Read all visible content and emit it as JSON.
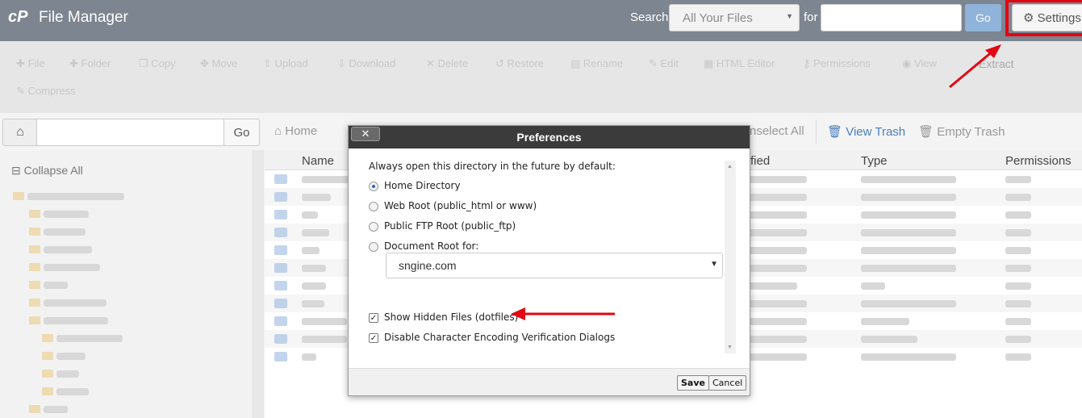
{
  "header": {
    "logo": "cP",
    "title": "File Manager",
    "search_label": "Search",
    "search_scope": "All Your Files",
    "for_label": "for",
    "search_value": "",
    "go_label": "Go",
    "settings_label": "Settings"
  },
  "toolbar": {
    "items": [
      "File",
      "Folder",
      "Copy",
      "Move",
      "Upload",
      "Download",
      "Delete",
      "Restore",
      "Rename",
      "Edit",
      "HTML Editor",
      "Permissions",
      "View",
      "Extract",
      "Compress"
    ]
  },
  "nav": {
    "path_value": "",
    "go_label": "Go",
    "home_label": "Home",
    "unselect_label": "nselect All",
    "view_trash_label": "View Trash",
    "empty_trash_label": "Empty Trash"
  },
  "tree": {
    "collapse_label": "Collapse All"
  },
  "table": {
    "columns": {
      "name": "Name",
      "modified": "fied",
      "type": "Type",
      "permissions": "Permissions"
    }
  },
  "dialog": {
    "title": "Preferences",
    "close_label": "✕",
    "intro": "Always open this directory in the future by default:",
    "options": [
      "Home Directory",
      "Web Root (public_html or www)",
      "Public FTP Root (public_ftp)",
      "Document Root for:"
    ],
    "selected_option": "Home Directory",
    "docroot_value": "sngine.com",
    "show_hidden_label": "Show Hidden Files (dotfiles)",
    "show_hidden_checked": true,
    "disable_encoding_label": "Disable Character Encoding Verification Dialogs",
    "disable_encoding_checked": true,
    "save_label": "Save",
    "cancel_label": "Cancel"
  },
  "colors": {
    "header_bg": "#7d8590",
    "annotation_red": "#e30613",
    "dialog_header": "#3b3b3b"
  }
}
